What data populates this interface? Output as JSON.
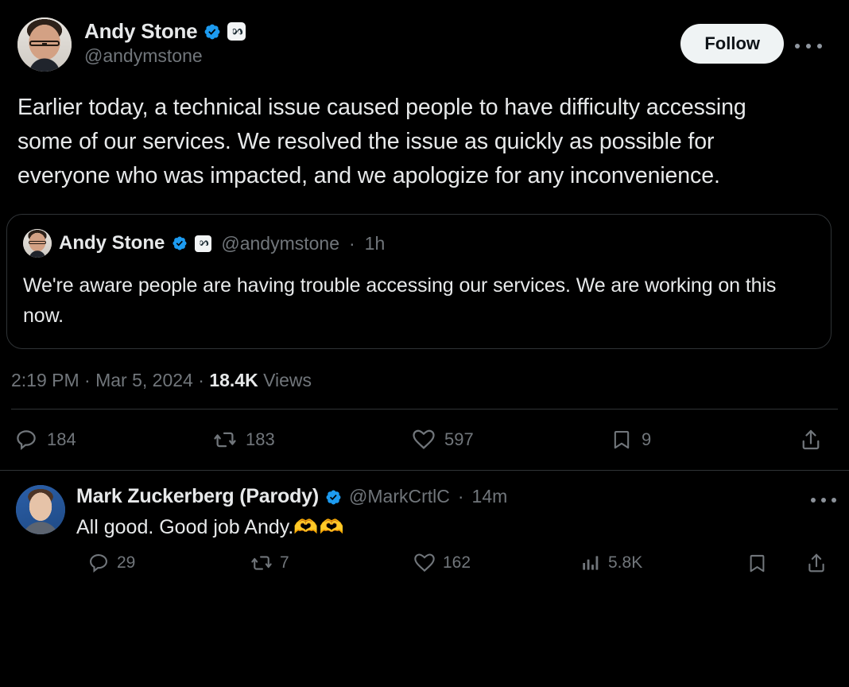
{
  "theme": {
    "background": "#000000",
    "text_primary": "#e7e9ea",
    "text_secondary": "#71767b",
    "verified_blue": "#1d9bf0",
    "follow_button_bg": "#eff3f4",
    "border": "#2f3336",
    "emoji_yellow": "#f2d44a"
  },
  "main_tweet": {
    "author": {
      "display_name": "Andy Stone",
      "handle": "@andymstone",
      "verified_icon": "verified-badge-icon",
      "affiliate_icon": "meta-logo-icon",
      "avatar_icon": "avatar-andy-stone"
    },
    "follow_label": "Follow",
    "more_icon": "more-options-icon",
    "body": "Earlier today, a technical issue caused people to have difficulty accessing some of our services. We resolved the issue as quickly as possible for everyone who was impacted, and we apologize for any inconvenience.",
    "quoted_tweet": {
      "display_name": "Andy Stone",
      "handle": "@andymstone",
      "verified_icon": "verified-badge-icon",
      "affiliate_icon": "meta-logo-icon",
      "avatar_icon": "avatar-andy-stone",
      "separator": "·",
      "time_ago": "1h",
      "body": "We're aware people are having trouble accessing our services. We are working on this now."
    },
    "timestamp": {
      "time": "2:19 PM",
      "sep1": "·",
      "date": "Mar 5, 2024",
      "sep2": "·",
      "views_count": "18.4K",
      "views_label": "Views"
    },
    "actions": {
      "reply": {
        "icon": "reply-icon",
        "count": "184"
      },
      "retweet": {
        "icon": "retweet-icon",
        "count": "183"
      },
      "like": {
        "icon": "like-heart-icon",
        "count": "597"
      },
      "bookmark": {
        "icon": "bookmark-icon",
        "count": "9"
      },
      "share": {
        "icon": "share-icon",
        "count": ""
      }
    }
  },
  "reply_tweet": {
    "author": {
      "display_name": "Mark Zuckerberg (Parody)",
      "handle": "@MarkCrtlC",
      "verified_icon": "verified-badge-icon",
      "avatar_icon": "avatar-mark-zuckerberg"
    },
    "separator": "·",
    "time_ago": "14m",
    "more_icon": "more-options-icon",
    "body_text": "All good. Good job Andy.",
    "body_emoji": "🫶🫶",
    "actions": {
      "reply": {
        "icon": "reply-icon",
        "count": "29"
      },
      "retweet": {
        "icon": "retweet-icon",
        "count": "7"
      },
      "like": {
        "icon": "like-heart-icon",
        "count": "162"
      },
      "views": {
        "icon": "analytics-bar-icon",
        "count": "5.8K"
      },
      "bookmark": {
        "icon": "bookmark-icon",
        "count": ""
      },
      "share": {
        "icon": "share-icon",
        "count": ""
      }
    }
  }
}
